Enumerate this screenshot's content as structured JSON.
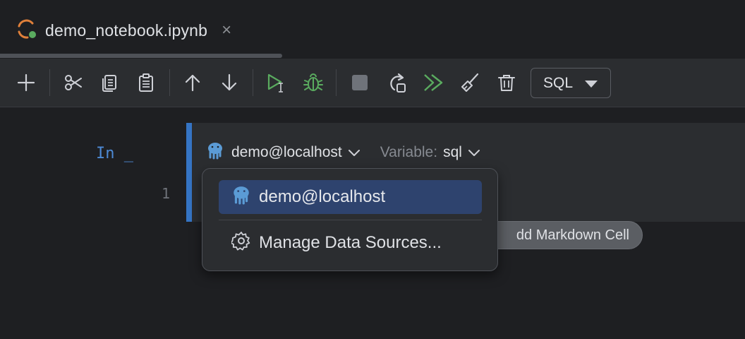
{
  "tab": {
    "title": "demo_notebook.ipynb",
    "close_glyph": "×",
    "icon": "jupyter-notebook-icon"
  },
  "toolbar": {
    "buttons": [
      {
        "name": "add-cell-button",
        "icon": "plus-icon"
      },
      {
        "name": "cut-cell-button",
        "icon": "scissors-icon"
      },
      {
        "name": "copy-cell-button",
        "icon": "copy-icon"
      },
      {
        "name": "paste-cell-button",
        "icon": "clipboard-icon"
      },
      {
        "name": "move-up-button",
        "icon": "arrow-up-icon"
      },
      {
        "name": "move-down-button",
        "icon": "arrow-down-icon"
      },
      {
        "name": "run-cell-button",
        "icon": "run-cursor-icon"
      },
      {
        "name": "debug-cell-button",
        "icon": "bug-icon"
      },
      {
        "name": "stop-button",
        "icon": "stop-icon"
      },
      {
        "name": "restart-kernel-button",
        "icon": "restart-icon"
      },
      {
        "name": "run-all-button",
        "icon": "run-all-icon"
      },
      {
        "name": "clear-outputs-button",
        "icon": "broom-icon"
      },
      {
        "name": "delete-cell-button",
        "icon": "trash-icon"
      }
    ],
    "cell_type": "SQL"
  },
  "cell": {
    "prompt": "In _",
    "line_number": "1",
    "data_source": "demo@localhost",
    "variable_label": "Variable:",
    "variable_value": "sql"
  },
  "add_markdown_label": "dd Markdown Cell",
  "popup": {
    "items": [
      {
        "label": "demo@localhost",
        "icon": "postgresql-elephant-icon",
        "selected": true
      },
      {
        "label": "Manage Data Sources...",
        "icon": "gear-icon",
        "selected": false
      }
    ]
  },
  "colors": {
    "accent": "#3574c4",
    "run_green": "#5aab5f",
    "selection": "#2e436e",
    "prompt_blue": "#4d8ad6",
    "postgres_blue": "#5b9bd5"
  }
}
